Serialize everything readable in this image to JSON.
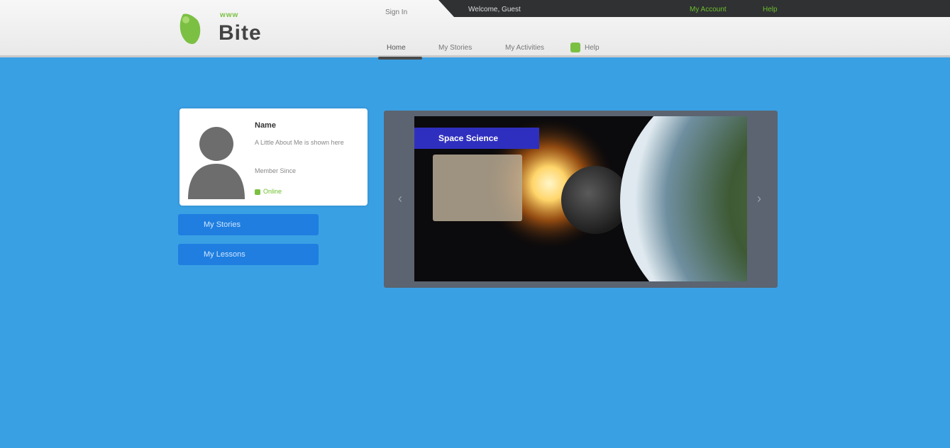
{
  "header": {
    "logo_small": "www",
    "logo_big": "Bite",
    "signin_label": "Sign In",
    "welcome_text": "Welcome, Guest",
    "green_link_1": "My Account",
    "green_link_2": "Help"
  },
  "nav": {
    "items": [
      "Home",
      "My Stories",
      "My Activities",
      "Help"
    ]
  },
  "profile": {
    "name": "Name",
    "line1": "A Little About Me is shown here",
    "line2": "Member Since",
    "status": "Online"
  },
  "buttons": {
    "my_stories": "My Stories",
    "my_lessons": "My Lessons"
  },
  "slide": {
    "title": "Space Science"
  },
  "colors": {
    "background": "#3aa0e4",
    "accent_green": "#7bc043",
    "button_blue": "#1f7ee0",
    "slide_title_bg": "#2f2fbf"
  }
}
